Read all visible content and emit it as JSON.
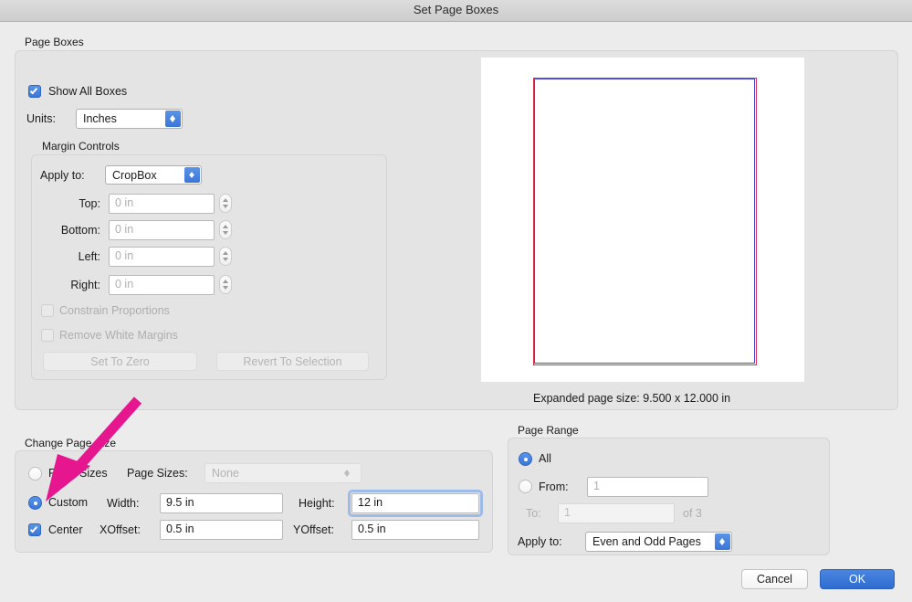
{
  "window": {
    "title": "Set Page Boxes"
  },
  "page_boxes": {
    "group_label": "Page Boxes",
    "show_all_boxes": {
      "label": "Show All Boxes",
      "checked": "true"
    },
    "units": {
      "label": "Units:",
      "value": "Inches"
    },
    "margin_controls": {
      "group_label": "Margin Controls",
      "apply_to": {
        "label": "Apply to:",
        "value": "CropBox"
      },
      "fields": [
        {
          "label": "Top:",
          "placeholder": "0 in"
        },
        {
          "label": "Bottom:",
          "placeholder": "0 in"
        },
        {
          "label": "Left:",
          "placeholder": "0 in"
        },
        {
          "label": "Right:",
          "placeholder": "0 in"
        }
      ],
      "constrain_proportions": {
        "label": "Constrain Proportions",
        "checked": "false"
      },
      "remove_white_margins": {
        "label": "Remove White Margins",
        "checked": "false"
      },
      "set_to_zero_label": "Set To Zero",
      "revert_to_selection_label": "Revert To Selection"
    }
  },
  "preview": {
    "expanded_page_size": "Expanded page size: 9.500 x 12.000 in",
    "page_outline_color": "#4a4ad0",
    "expanded_outline_color": "#e02a4e"
  },
  "change_page_size": {
    "group_label": "Change Page Size",
    "fixed_sizes": {
      "label": "Fixed Sizes",
      "selected": "false"
    },
    "page_sizes": {
      "label": "Page Sizes:",
      "value": "None"
    },
    "custom": {
      "label": "Custom",
      "selected": "true"
    },
    "width": {
      "label": "Width:",
      "value": "9.5 in"
    },
    "height": {
      "label": "Height:",
      "value": "12 in"
    },
    "center": {
      "label": "Center",
      "checked": "true"
    },
    "xoffset": {
      "label": "XOffset:",
      "value": "0.5 in"
    },
    "yoffset": {
      "label": "YOffset:",
      "value": "0.5 in"
    }
  },
  "page_range": {
    "group_label": "Page Range",
    "all": {
      "label": "All",
      "selected": "true"
    },
    "from": {
      "label": "From:",
      "value": "1",
      "selected": "false"
    },
    "to": {
      "label": "To:",
      "value": "1"
    },
    "of_total": "of 3",
    "apply_to": {
      "label": "Apply to:",
      "value": "Even and Odd Pages"
    }
  },
  "footer": {
    "cancel_label": "Cancel",
    "ok_label": "OK"
  },
  "annotation": {
    "arrow_color": "#e6168f"
  }
}
